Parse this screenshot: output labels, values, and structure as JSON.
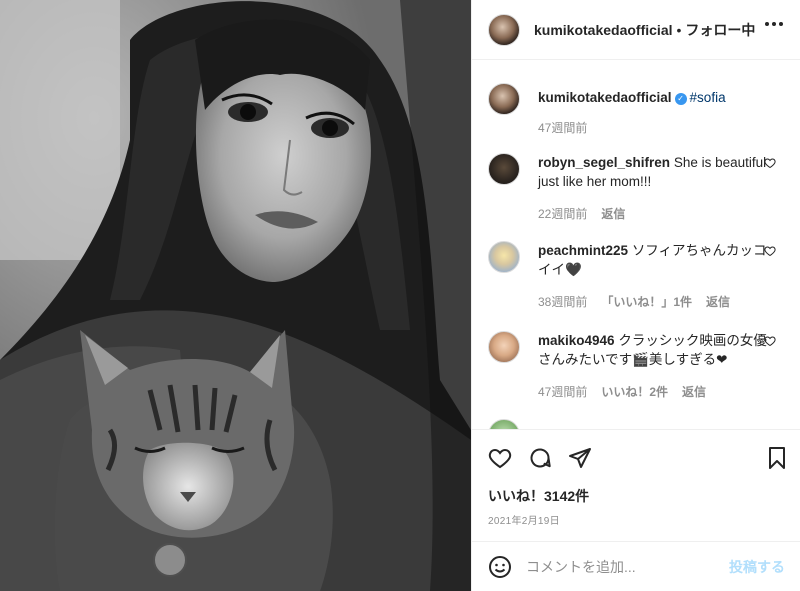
{
  "post": {
    "author": "kumikotakedaofficial",
    "separator": "•",
    "follow_status": "フォロー中",
    "more_icon": "more-horizontal-icon"
  },
  "caption": {
    "user": "kumikotakedaofficial",
    "hashtag": "#sofia",
    "time": "47週間前"
  },
  "comments": [
    {
      "user": "robyn_segel_shifren",
      "text": "She is beautiful just like her mom!!!",
      "time": "22週間前",
      "likes": "",
      "reply": "返信"
    },
    {
      "user": "peachmint225",
      "text": "ソフィアちゃんカッコイイ🖤",
      "time": "38週間前",
      "likes": "「いいね！」1件",
      "reply": "返信"
    },
    {
      "user": "makiko4946",
      "text": "クラッシック映画の女優さんみたいです🎬美しすぎる❤",
      "time": "47週間前",
      "likes": "いいね！2件",
      "reply": "返信"
    }
  ],
  "actions": {
    "likes_count": "いいね！3142件",
    "date": "2021年2月19日"
  },
  "composer": {
    "placeholder": "コメントを追加...",
    "post_label": "投稿する"
  },
  "colors": {
    "accent": "#0095f6",
    "post_button_disabled": "#b2dffc",
    "hashtag": "#00376b",
    "muted": "#8e8e8e"
  }
}
